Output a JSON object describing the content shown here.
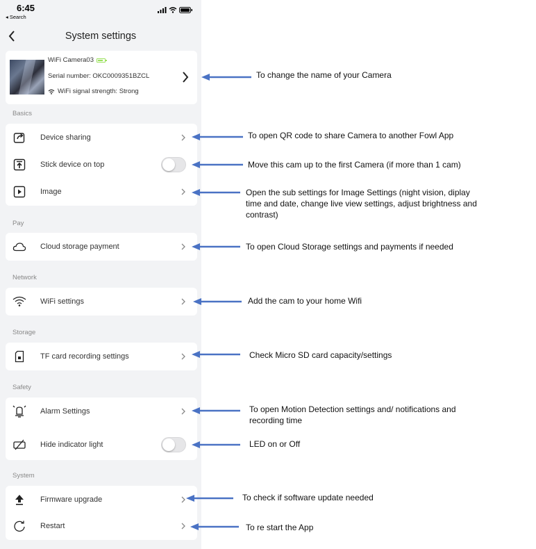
{
  "status_bar": {
    "time": "6:45",
    "back_app": "◂ Search"
  },
  "nav": {
    "title": "System settings"
  },
  "device": {
    "name": "WiFi Camera03",
    "serial": "Serial number: OKC0009351BZCL",
    "wifi_strength": "WiFi signal strength: Strong",
    "battery_color": "#9be15d"
  },
  "sections": {
    "basics": "Basics",
    "pay": "Pay",
    "network": "Network",
    "storage": "Storage",
    "safety": "Safety",
    "system": "System"
  },
  "items": {
    "device_sharing": "Device sharing",
    "stick_on_top": "Stick device on top",
    "image": "Image",
    "cloud_storage": "Cloud storage payment",
    "wifi_settings": "WiFi settings",
    "tf_card": "TF card recording settings",
    "alarm": "Alarm Settings",
    "hide_indicator": "Hide indicator light",
    "firmware": "Firmware upgrade",
    "restart": "Restart"
  },
  "toggles": {
    "stick_on_top": false,
    "hide_indicator": false
  },
  "annotations": {
    "rename": "To change the name of your Camera",
    "sharing": "To open QR code to share Camera to another Fowl App",
    "stick": "Move this cam up to the first Camera (if more than 1 cam)",
    "image": "Open the sub settings for Image Settings (night vision, diplay time and date, change live view settings, adjust brightness and contrast)",
    "cloud": "To open Cloud Storage settings and payments if needed",
    "wifi": "Add the cam to your home Wifi",
    "sd": "Check Micro SD card capacity/settings",
    "alarm": "To open Motion Detection settings and/ notifications and recording time",
    "led": "LED on or Off",
    "firmware": "To check if software update needed",
    "restart": "To re start the App"
  },
  "colors": {
    "arrow": "#4a72c4",
    "background": "#f2f3f5",
    "card": "#ffffff"
  }
}
